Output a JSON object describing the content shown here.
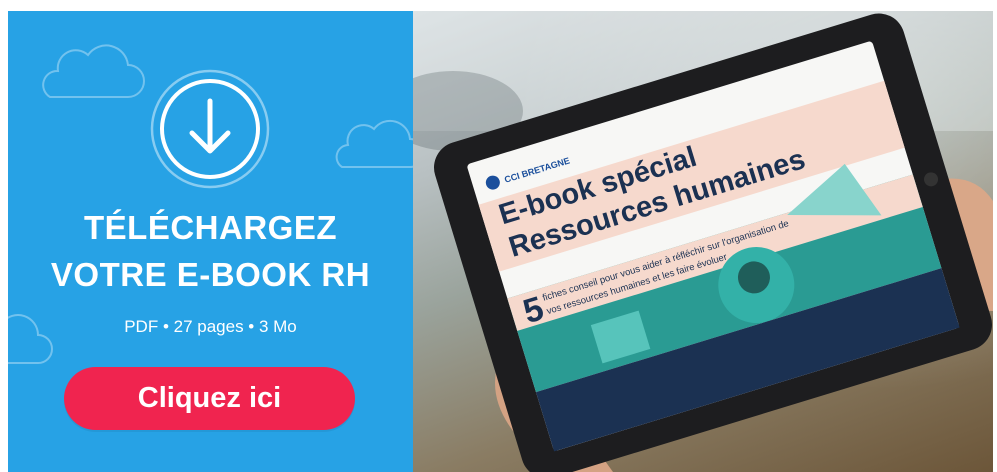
{
  "banner": {
    "headline_line1": "TÉLÉCHARGEZ",
    "headline_line2": "VOTRE E-BOOK RH",
    "file_info": "PDF • 27 pages • 3 Mo",
    "cta_label": "Cliquez ici",
    "icon": "download-arrow-icon",
    "colors": {
      "panel": "#27a2e5",
      "cta": "#f0244f",
      "text": "#ffffff"
    }
  },
  "tablet_screen": {
    "brand": "CCI BRETAGNE",
    "title_line1": "E-book spécial",
    "title_line2": "Ressources humaines",
    "number": "5",
    "subtitle_line1": "fiches conseil pour vous aider à réfléchir sur l'organisation de",
    "subtitle_line2": "vos ressources humaines et les faire évoluer"
  }
}
